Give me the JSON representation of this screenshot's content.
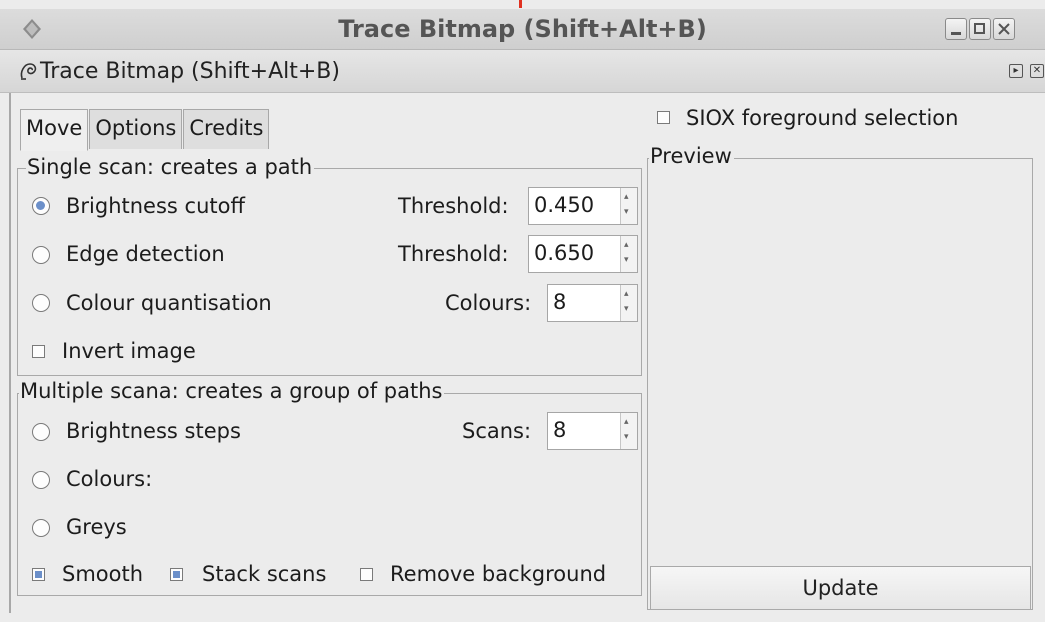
{
  "window": {
    "title": "Trace Bitmap (Shift+Alt+B)",
    "controls": [
      "minimize-icon",
      "maximize-icon",
      "close-icon"
    ]
  },
  "dock": {
    "title": "Trace Bitmap (Shift+Alt+B)",
    "controls": [
      "dock-expand-icon",
      "dock-close-icon"
    ]
  },
  "tabs": [
    "Move",
    "Options",
    "Credits"
  ],
  "single_scan": {
    "legend": "Single scan: creates a path",
    "brightness_cutoff": {
      "label": "Brightness cutoff",
      "selected": true,
      "param_label": "Threshold:",
      "value": "0.450"
    },
    "edge_detection": {
      "label": "Edge detection",
      "selected": false,
      "param_label": "Threshold:",
      "value": "0.650"
    },
    "colour_quantisation": {
      "label": "Colour quantisation",
      "selected": false,
      "param_label": "Colours:",
      "value": "8"
    },
    "invert_image": {
      "label": "Invert image",
      "checked": false
    }
  },
  "multiple_scan": {
    "legend": "Multiple scana: creates a group of paths",
    "brightness_steps": {
      "label": "Brightness steps",
      "selected": false,
      "param_label": "Scans:",
      "value": "8"
    },
    "colours": {
      "label": "Colours:",
      "selected": false
    },
    "greys": {
      "label": "Greys",
      "selected": false
    },
    "smooth": {
      "label": "Smooth",
      "checked": true
    },
    "stack_scans": {
      "label": "Stack scans",
      "checked": true
    },
    "remove_background": {
      "label": "Remove background",
      "checked": false
    }
  },
  "siox": {
    "label": "SIOX foreground selection",
    "checked": false
  },
  "preview": {
    "legend": "Preview",
    "update_label": "Update"
  },
  "colors": {
    "accent": "#6b8fc9",
    "window_bg": "#ececec",
    "border": "#a9a9a9"
  }
}
